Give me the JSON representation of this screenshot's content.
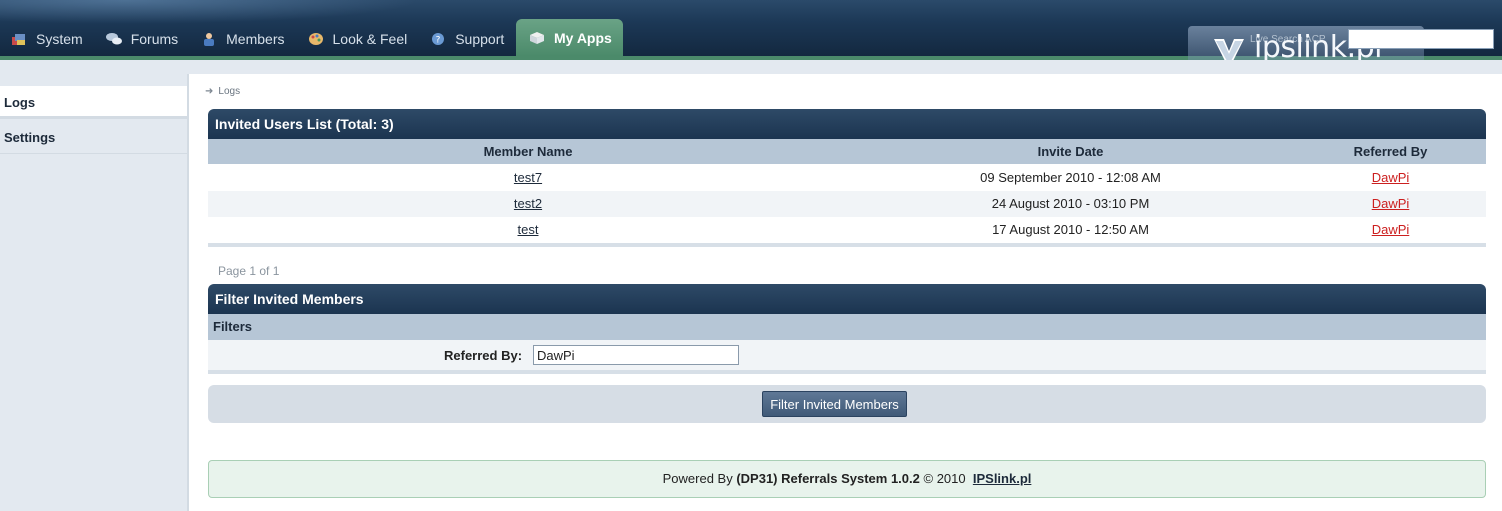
{
  "nav": {
    "items": [
      {
        "label": "System",
        "icon": "system-icon"
      },
      {
        "label": "Forums",
        "icon": "forums-icon"
      },
      {
        "label": "Members",
        "icon": "members-icon"
      },
      {
        "label": "Look & Feel",
        "icon": "look-feel-icon"
      },
      {
        "label": "Support",
        "icon": "support-icon"
      }
    ],
    "active": {
      "label": "My Apps",
      "icon": "my-apps-icon"
    }
  },
  "logo": {
    "text": "ipslink.pl"
  },
  "search": {
    "label": "Live Search ACP",
    "value": ""
  },
  "sidebar": {
    "items": [
      {
        "label": "Logs",
        "active": true
      },
      {
        "label": "Settings",
        "active": false
      }
    ]
  },
  "breadcrumb": {
    "items": [
      "Logs"
    ]
  },
  "invited": {
    "title": "Invited Users List (Total: 3)",
    "columns": [
      "Member Name",
      "Invite Date",
      "Referred By"
    ],
    "rows": [
      {
        "member": "test7",
        "date": "09 September 2010 - 12:08 AM",
        "referred_by": "DawPi"
      },
      {
        "member": "test2",
        "date": "24 August 2010 - 03:10 PM",
        "referred_by": "DawPi"
      },
      {
        "member": "test",
        "date": "17 August 2010 - 12:50 AM",
        "referred_by": "DawPi"
      }
    ],
    "pager": "Page 1 of 1"
  },
  "filter": {
    "title": "Filter Invited Members",
    "subheader": "Filters",
    "referred_by_label": "Referred By:",
    "referred_by_value": "DawPi",
    "submit_label": "Filter Invited Members"
  },
  "footer": {
    "prefix": "Powered By",
    "product": "(DP31) Referrals System 1.0.2",
    "copyright": "© 2010",
    "link": "IPSlink.pl"
  },
  "colors": {
    "header": "#1c3856",
    "accent_green": "#4b8a6a",
    "link_red": "#cc1f1f",
    "table_header": "#b6c6d6"
  }
}
